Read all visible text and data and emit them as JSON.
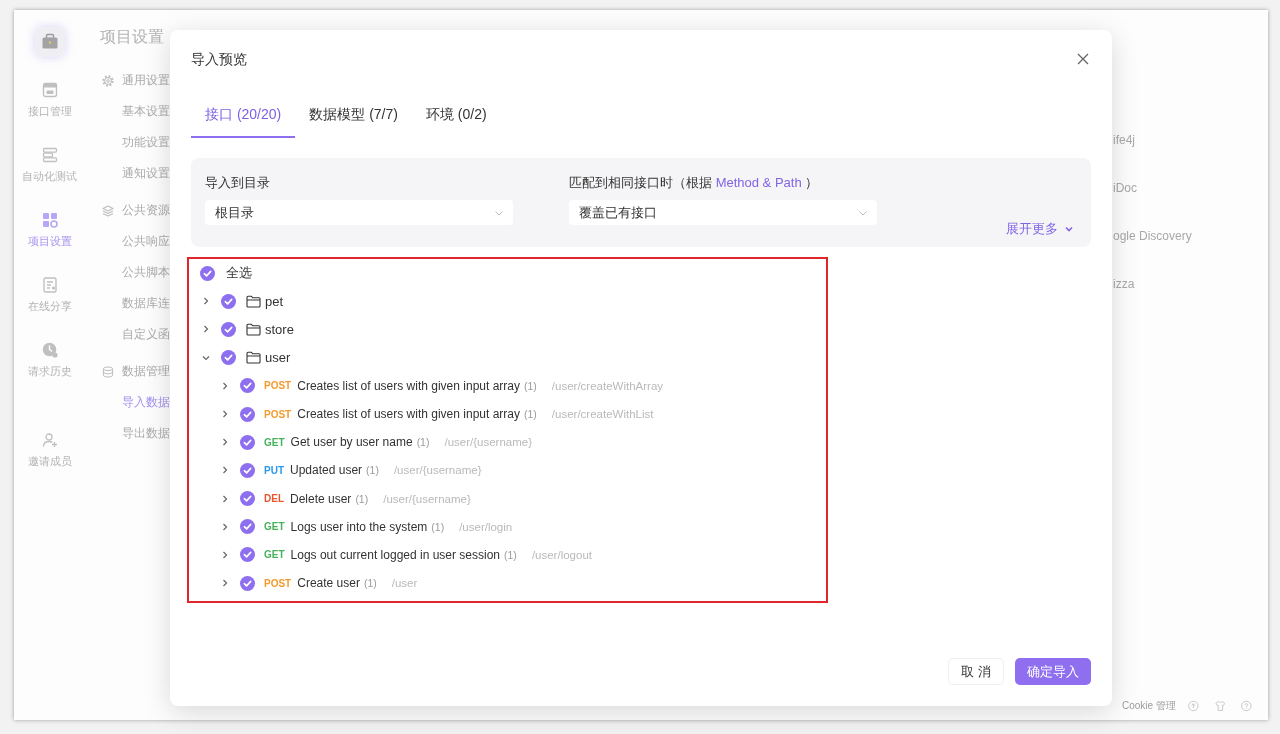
{
  "sidebar": {
    "items": [
      {
        "label": "接口管理",
        "selected": false
      },
      {
        "label": "自动化测试",
        "selected": false
      },
      {
        "label": "项目设置",
        "selected": true
      },
      {
        "label": "在线分享",
        "selected": false
      },
      {
        "label": "请求历史",
        "selected": false
      }
    ],
    "invite": {
      "label": "邀请成员"
    }
  },
  "settings_menu": {
    "title": "项目设置",
    "groups": [
      {
        "label": "通用设置",
        "items": [
          {
            "label": "基本设置",
            "selected": false
          },
          {
            "label": "功能设置",
            "selected": false
          },
          {
            "label": "通知设置",
            "selected": false
          }
        ]
      },
      {
        "label": "公共资源",
        "items": [
          {
            "label": "公共响应",
            "selected": false
          },
          {
            "label": "公共脚本",
            "selected": false
          },
          {
            "label": "数据库连",
            "selected": false
          },
          {
            "label": "自定义函",
            "selected": false
          }
        ]
      },
      {
        "label": "数据管理",
        "items": [
          {
            "label": "导入数据",
            "selected": true
          },
          {
            "label": "导出数据",
            "selected": false
          }
        ]
      }
    ]
  },
  "import_formats": [
    "ife4j",
    "iDoc",
    "ogle Discovery",
    "izza"
  ],
  "footer": {
    "cookie_link": "Cookie 管理"
  },
  "dialog": {
    "title": "导入预览",
    "tabs": [
      {
        "label": "接口 (20/20)",
        "selected": true
      },
      {
        "label": "数据模型 (7/7)",
        "selected": false
      },
      {
        "label": "环境 (0/2)",
        "selected": false
      }
    ],
    "options": {
      "target": {
        "label": "导入到目录",
        "value": "根目录"
      },
      "match": {
        "label": "匹配到相同接口时（根据",
        "link": "Method & Path",
        "label_end": "）",
        "value": "覆盖已有接口"
      },
      "expand_more": "展开更多"
    },
    "tree": {
      "select_all": {
        "label": "全选",
        "checked": true
      },
      "folders": [
        {
          "name": "pet",
          "checked": true,
          "expanded": false
        },
        {
          "name": "store",
          "checked": true,
          "expanded": false
        },
        {
          "name": "user",
          "checked": true,
          "expanded": true,
          "children": [
            {
              "method": "POST",
              "color": "#f59a2c",
              "name": "Creates list of users with given input array",
              "count": "(1)",
              "path": "/user/createWithArray",
              "checked": true,
              "expanded": false
            },
            {
              "method": "POST",
              "color": "#f59a2c",
              "name": "Creates list of users with given input array",
              "count": "(1)",
              "path": "/user/createWithList",
              "checked": true,
              "expanded": false
            },
            {
              "method": "GET",
              "color": "#47b05a",
              "name": "Get user by user name",
              "count": "(1)",
              "path": "/user/{username}",
              "checked": true,
              "expanded": false
            },
            {
              "method": "PUT",
              "color": "#2a98ee",
              "name": "Updated user",
              "count": "(1)",
              "path": "/user/{username}",
              "checked": true,
              "expanded": false
            },
            {
              "method": "DEL",
              "color": "#e9552e",
              "name": "Delete user",
              "count": "(1)",
              "path": "/user/{username}",
              "checked": true,
              "expanded": false
            },
            {
              "method": "GET",
              "color": "#47b05a",
              "name": "Logs user into the system",
              "count": "(1)",
              "path": "/user/login",
              "checked": true,
              "expanded": false
            },
            {
              "method": "GET",
              "color": "#47b05a",
              "name": "Logs out current logged in user session",
              "count": "(1)",
              "path": "/user/logout",
              "checked": true,
              "expanded": false
            },
            {
              "method": "POST",
              "color": "#f59a2c",
              "name": "Create user",
              "count": "(1)",
              "path": "/user",
              "checked": true,
              "expanded": false
            }
          ]
        }
      ]
    },
    "buttons": [
      {
        "label": "取 消",
        "kind": "secondary"
      },
      {
        "label": "确定导入",
        "kind": "primary"
      }
    ]
  }
}
